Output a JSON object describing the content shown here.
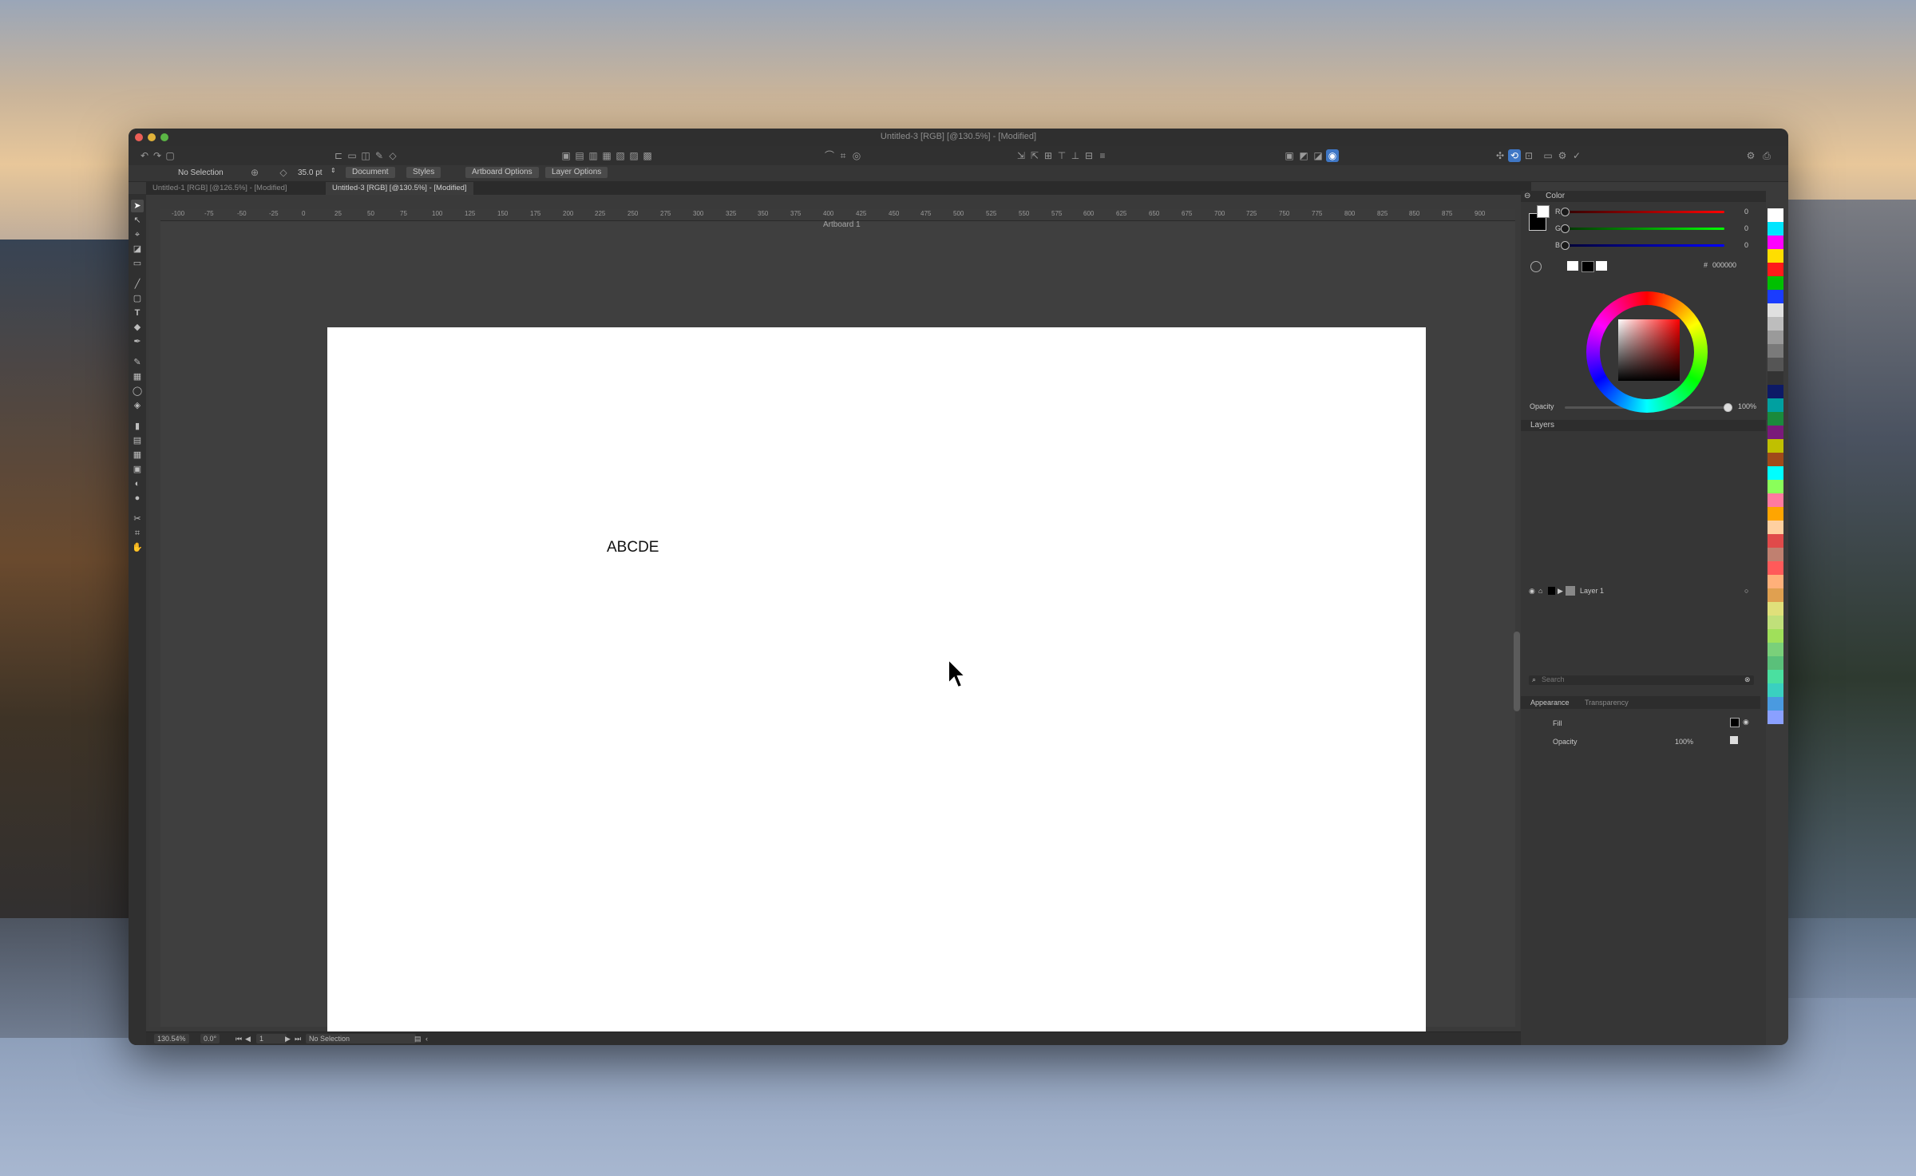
{
  "window": {
    "title": "Untitled-3 [RGB] [@130.5%] - [Modified]"
  },
  "context_bar": {
    "selection": "No Selection",
    "size": "35.0 pt",
    "buttons": [
      "Document",
      "Styles",
      "Artboard Options",
      "Layer Options"
    ]
  },
  "tabs": [
    {
      "label": "Untitled-1 [RGB] [@126.5%] - [Modified]",
      "active": false
    },
    {
      "label": "Untitled-3 [RGB] [@130.5%] - [Modified]",
      "active": true
    }
  ],
  "ruler": {
    "h_labels": [
      "-100",
      "-75",
      "-50",
      "-25",
      "0",
      "25",
      "50",
      "75",
      "100",
      "125",
      "150",
      "175",
      "200",
      "225",
      "250",
      "275",
      "300",
      "325",
      "350",
      "375",
      "400",
      "425",
      "450",
      "475",
      "500",
      "525",
      "550",
      "575",
      "600",
      "625",
      "650",
      "675",
      "700",
      "725",
      "750",
      "775",
      "800",
      "825",
      "850",
      "875",
      "900"
    ]
  },
  "artboard": {
    "label": "Artboard 1",
    "text": "ABCDE"
  },
  "color_panel": {
    "title": "Color",
    "r_label": "R",
    "g_label": "G",
    "b_label": "B",
    "r_value": "0",
    "g_value": "0",
    "b_value": "0",
    "hex_prefix": "#",
    "hex_value": "000000",
    "opacity_label": "Opacity",
    "opacity_value": "100%"
  },
  "layers_panel": {
    "title": "Layers",
    "layers": [
      {
        "name": "Layer 1"
      }
    ],
    "search_placeholder": "Search"
  },
  "appearance_panel": {
    "tabs": [
      "Appearance",
      "Transparency"
    ],
    "fill_label": "Fill",
    "opacity_label": "Opacity",
    "opacity_value": "100%"
  },
  "status_bar": {
    "zoom": "130.54%",
    "rotation": "0.0°",
    "page": "1",
    "selection": "No Selection"
  },
  "colors": {
    "accent": "#3f77c5",
    "canvas_bg": "#3f3f3f",
    "panel_bg": "#363636",
    "artboard": "#ffffff"
  }
}
